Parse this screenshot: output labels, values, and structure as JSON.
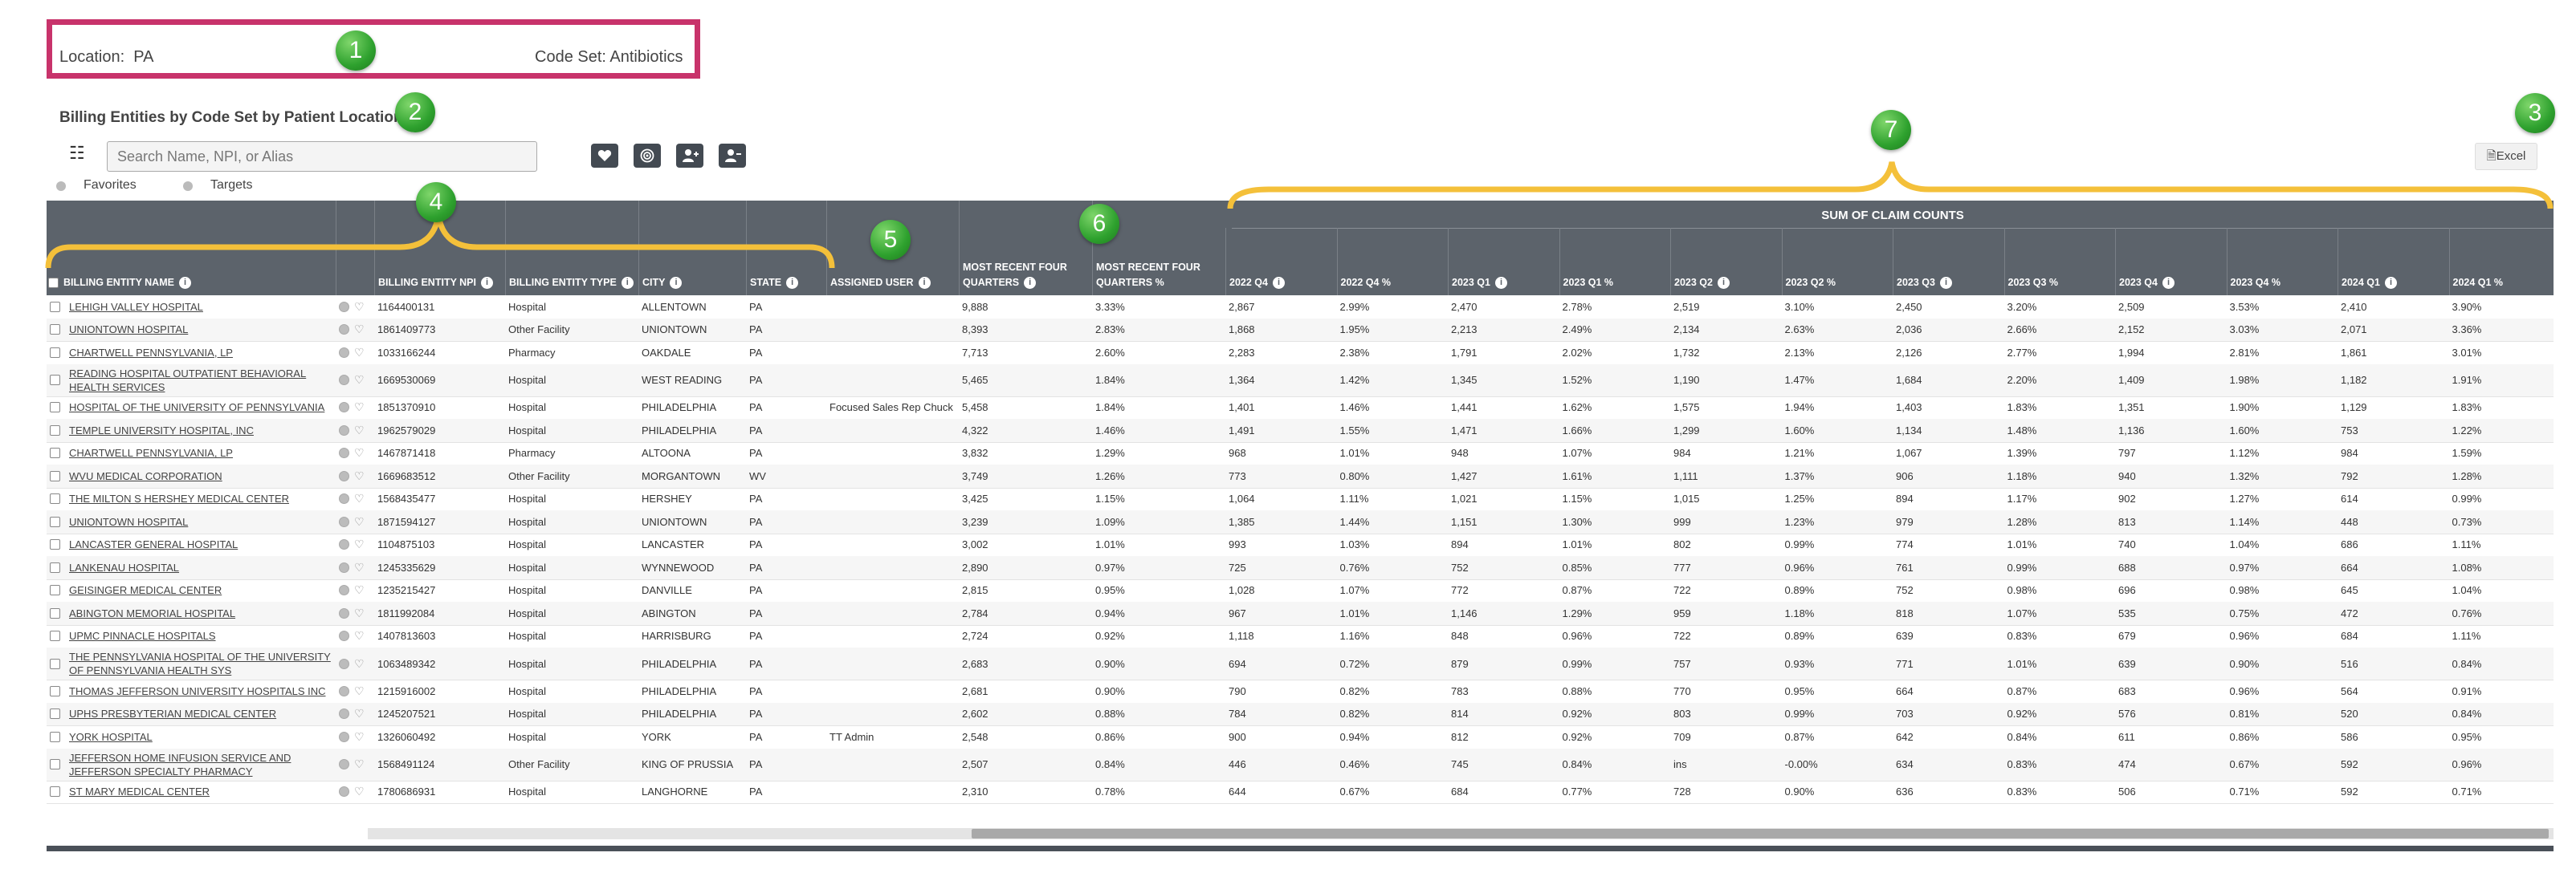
{
  "location": {
    "label": "Location:",
    "value": "PA"
  },
  "code_set": {
    "label": "Code Set:",
    "value": "Antibiotics"
  },
  "section_title": "Billing Entities by Code Set by Patient Location",
  "search": {
    "placeholder": "Search Name, NPI, or Alias"
  },
  "toolbar": {
    "excel_label": "Excel"
  },
  "legend": {
    "favorites": "Favorites",
    "targets": "Targets"
  },
  "badges": [
    "1",
    "2",
    "3",
    "4",
    "5",
    "6",
    "7"
  ],
  "headers": {
    "name": "BILLING ENTITY NAME",
    "npi": "BILLING ENTITY NPI",
    "type": "BILLING ENTITY TYPE",
    "city": "CITY",
    "state": "STATE",
    "assigned": "ASSIGNED USER",
    "mrfq": "MOST RECENT FOUR QUARTERS",
    "mrfq_pct": "MOST RECENT FOUR QUARTERS %",
    "q22q4": "2022 Q4",
    "q22q4p": "2022 Q4 %",
    "q23q1": "2023 Q1",
    "q23q1p": "2023 Q1 %",
    "q23q2": "2023 Q2",
    "q23q2p": "2023 Q2 %",
    "q23q3": "2023 Q3",
    "q23q3p": "2023 Q3 %",
    "q23q4": "2023 Q4",
    "q23q4p": "2023 Q4 %",
    "q24q1": "2024 Q1",
    "q24q1p": "2024 Q1 %",
    "sum": "SUM OF CLAIM COUNTS"
  },
  "colors": {
    "header_bg": "#5c636b",
    "badge_green": "#2ea12e",
    "brace_yellow": "#f4c03a",
    "box_pink": "#c8336b"
  },
  "rows": [
    [
      "LEHIGH VALLEY HOSPITAL",
      "1164400131",
      "Hospital",
      "ALLENTOWN",
      "PA",
      "",
      "9,888",
      "3.33%",
      "2,867",
      "2.99%",
      "2,470",
      "2.78%",
      "2,519",
      "3.10%",
      "2,450",
      "3.20%",
      "2,509",
      "3.53%",
      "2,410",
      "3.90%"
    ],
    [
      "UNIONTOWN HOSPITAL",
      "1861409773",
      "Other Facility",
      "UNIONTOWN",
      "PA",
      "",
      "8,393",
      "2.83%",
      "1,868",
      "1.95%",
      "2,213",
      "2.49%",
      "2,134",
      "2.63%",
      "2,036",
      "2.66%",
      "2,152",
      "3.03%",
      "2,071",
      "3.36%"
    ],
    [
      "CHARTWELL PENNSYLVANIA, LP",
      "1033166244",
      "Pharmacy",
      "OAKDALE",
      "PA",
      "",
      "7,713",
      "2.60%",
      "2,283",
      "2.38%",
      "1,791",
      "2.02%",
      "1,732",
      "2.13%",
      "2,126",
      "2.77%",
      "1,994",
      "2.81%",
      "1,861",
      "3.01%"
    ],
    [
      "READING HOSPITAL OUTPATIENT BEHAVIORAL HEALTH SERVICES",
      "1669530069",
      "Hospital",
      "WEST READING",
      "PA",
      "",
      "5,465",
      "1.84%",
      "1,364",
      "1.42%",
      "1,345",
      "1.52%",
      "1,190",
      "1.47%",
      "1,684",
      "2.20%",
      "1,409",
      "1.98%",
      "1,182",
      "1.91%"
    ],
    [
      "HOSPITAL OF THE UNIVERSITY OF PENNSYLVANIA",
      "1851370910",
      "Hospital",
      "PHILADELPHIA",
      "PA",
      "Focused Sales Rep Chuck",
      "5,458",
      "1.84%",
      "1,401",
      "1.46%",
      "1,441",
      "1.62%",
      "1,575",
      "1.94%",
      "1,403",
      "1.83%",
      "1,351",
      "1.90%",
      "1,129",
      "1.83%"
    ],
    [
      "TEMPLE UNIVERSITY HOSPITAL, INC",
      "1962579029",
      "Hospital",
      "PHILADELPHIA",
      "PA",
      "",
      "4,322",
      "1.46%",
      "1,491",
      "1.55%",
      "1,471",
      "1.66%",
      "1,299",
      "1.60%",
      "1,134",
      "1.48%",
      "1,136",
      "1.60%",
      "753",
      "1.22%"
    ],
    [
      "CHARTWELL PENNSYLVANIA, LP",
      "1467871418",
      "Pharmacy",
      "ALTOONA",
      "PA",
      "",
      "3,832",
      "1.29%",
      "968",
      "1.01%",
      "948",
      "1.07%",
      "984",
      "1.21%",
      "1,067",
      "1.39%",
      "797",
      "1.12%",
      "984",
      "1.59%"
    ],
    [
      "WVU MEDICAL CORPORATION",
      "1669683512",
      "Other Facility",
      "MORGANTOWN",
      "WV",
      "",
      "3,749",
      "1.26%",
      "773",
      "0.80%",
      "1,427",
      "1.61%",
      "1,111",
      "1.37%",
      "906",
      "1.18%",
      "940",
      "1.32%",
      "792",
      "1.28%"
    ],
    [
      "THE MILTON S HERSHEY MEDICAL CENTER",
      "1568435477",
      "Hospital",
      "HERSHEY",
      "PA",
      "",
      "3,425",
      "1.15%",
      "1,064",
      "1.11%",
      "1,021",
      "1.15%",
      "1,015",
      "1.25%",
      "894",
      "1.17%",
      "902",
      "1.27%",
      "614",
      "0.99%"
    ],
    [
      "UNIONTOWN HOSPITAL",
      "1871594127",
      "Hospital",
      "UNIONTOWN",
      "PA",
      "",
      "3,239",
      "1.09%",
      "1,385",
      "1.44%",
      "1,151",
      "1.30%",
      "999",
      "1.23%",
      "979",
      "1.28%",
      "813",
      "1.14%",
      "448",
      "0.73%"
    ],
    [
      "LANCASTER GENERAL HOSPITAL",
      "1104875103",
      "Hospital",
      "LANCASTER",
      "PA",
      "",
      "3,002",
      "1.01%",
      "993",
      "1.03%",
      "894",
      "1.01%",
      "802",
      "0.99%",
      "774",
      "1.01%",
      "740",
      "1.04%",
      "686",
      "1.11%"
    ],
    [
      "LANKENAU HOSPITAL",
      "1245335629",
      "Hospital",
      "WYNNEWOOD",
      "PA",
      "",
      "2,890",
      "0.97%",
      "725",
      "0.76%",
      "752",
      "0.85%",
      "777",
      "0.96%",
      "761",
      "0.99%",
      "688",
      "0.97%",
      "664",
      "1.08%"
    ],
    [
      "GEISINGER MEDICAL CENTER",
      "1235215427",
      "Hospital",
      "DANVILLE",
      "PA",
      "",
      "2,815",
      "0.95%",
      "1,028",
      "1.07%",
      "772",
      "0.87%",
      "722",
      "0.89%",
      "752",
      "0.98%",
      "696",
      "0.98%",
      "645",
      "1.04%"
    ],
    [
      "ABINGTON MEMORIAL HOSPITAL",
      "1811992084",
      "Hospital",
      "ABINGTON",
      "PA",
      "",
      "2,784",
      "0.94%",
      "967",
      "1.01%",
      "1,146",
      "1.29%",
      "959",
      "1.18%",
      "818",
      "1.07%",
      "535",
      "0.75%",
      "472",
      "0.76%"
    ],
    [
      "UPMC PINNACLE HOSPITALS",
      "1407813603",
      "Hospital",
      "HARRISBURG",
      "PA",
      "",
      "2,724",
      "0.92%",
      "1,118",
      "1.16%",
      "848",
      "0.96%",
      "722",
      "0.89%",
      "639",
      "0.83%",
      "679",
      "0.96%",
      "684",
      "1.11%"
    ],
    [
      "THE PENNSYLVANIA HOSPITAL OF THE UNIVERSITY OF PENNSYLVANIA HEALTH SYS",
      "1063489342",
      "Hospital",
      "PHILADELPHIA",
      "PA",
      "",
      "2,683",
      "0.90%",
      "694",
      "0.72%",
      "879",
      "0.99%",
      "757",
      "0.93%",
      "771",
      "1.01%",
      "639",
      "0.90%",
      "516",
      "0.84%"
    ],
    [
      "THOMAS JEFFERSON UNIVERSITY HOSPITALS INC",
      "1215916002",
      "Hospital",
      "PHILADELPHIA",
      "PA",
      "",
      "2,681",
      "0.90%",
      "790",
      "0.82%",
      "783",
      "0.88%",
      "770",
      "0.95%",
      "664",
      "0.87%",
      "683",
      "0.96%",
      "564",
      "0.91%"
    ],
    [
      "UPHS PRESBYTERIAN MEDICAL CENTER",
      "1245207521",
      "Hospital",
      "PHILADELPHIA",
      "PA",
      "",
      "2,602",
      "0.88%",
      "784",
      "0.82%",
      "814",
      "0.92%",
      "803",
      "0.99%",
      "703",
      "0.92%",
      "576",
      "0.81%",
      "520",
      "0.84%"
    ],
    [
      "YORK HOSPITAL",
      "1326060492",
      "Hospital",
      "YORK",
      "PA",
      "TT Admin",
      "2,548",
      "0.86%",
      "900",
      "0.94%",
      "812",
      "0.92%",
      "709",
      "0.87%",
      "642",
      "0.84%",
      "611",
      "0.86%",
      "586",
      "0.95%"
    ],
    [
      "JEFFERSON HOME INFUSION SERVICE AND JEFFERSON SPECIALTY PHARMACY",
      "1568491124",
      "Other Facility",
      "KING OF PRUSSIA",
      "PA",
      "",
      "2,507",
      "0.84%",
      "446",
      "0.46%",
      "745",
      "0.84%",
      "ins",
      "-0.00%",
      "634",
      "0.83%",
      "474",
      "0.67%",
      "592",
      "0.96%"
    ],
    [
      "ST MARY MEDICAL CENTER",
      "1780686931",
      "Hospital",
      "LANGHORNE",
      "PA",
      "",
      "2,310",
      "0.78%",
      "644",
      "0.67%",
      "684",
      "0.77%",
      "728",
      "0.90%",
      "636",
      "0.83%",
      "506",
      "0.71%",
      "592",
      "0.71%"
    ]
  ]
}
